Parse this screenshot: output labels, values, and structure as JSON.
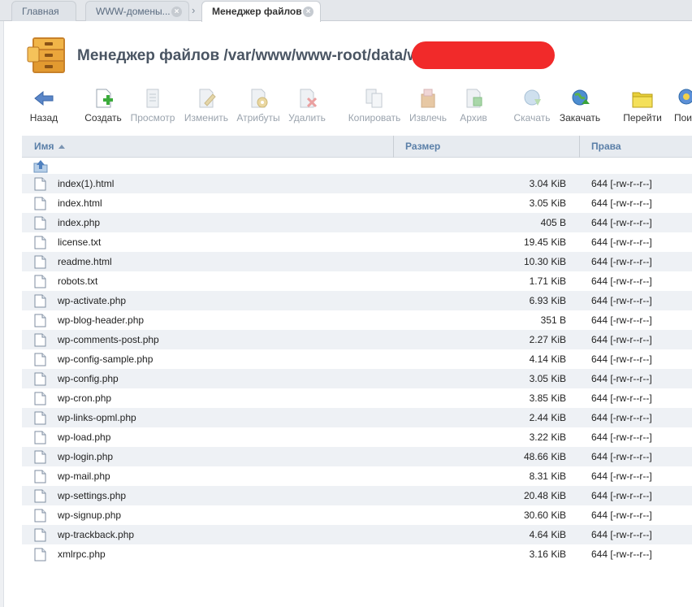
{
  "tabs": {
    "home": "Главная",
    "domains": "WWW-домены...",
    "separator": "›",
    "filemanager": "Менеджер файлов",
    "close_glyph": "×"
  },
  "header": {
    "title": "Менеджер файлов /var/www/www-root/data/ww"
  },
  "toolbar": {
    "back": "Назад",
    "create": "Создать",
    "view": "Просмотр",
    "edit": "Изменить",
    "attributes": "Атрибуты",
    "delete": "Удалить",
    "copy": "Копировать",
    "extract": "Извлечь",
    "archive": "Архив",
    "download": "Скачать",
    "upload": "Закачать",
    "goto": "Перейти",
    "search": "Пои"
  },
  "table": {
    "col_name": "Имя",
    "col_size": "Размер",
    "col_perms": "Права",
    "rows": [
      {
        "name": "index(1).html",
        "size": "3.04 KiB",
        "perms": "644 [-rw-r--r--]"
      },
      {
        "name": "index.html",
        "size": "3.05 KiB",
        "perms": "644 [-rw-r--r--]"
      },
      {
        "name": "index.php",
        "size": "405 B",
        "perms": "644 [-rw-r--r--]"
      },
      {
        "name": "license.txt",
        "size": "19.45 KiB",
        "perms": "644 [-rw-r--r--]"
      },
      {
        "name": "readme.html",
        "size": "10.30 KiB",
        "perms": "644 [-rw-r--r--]"
      },
      {
        "name": "robots.txt",
        "size": "1.71 KiB",
        "perms": "644 [-rw-r--r--]"
      },
      {
        "name": "wp-activate.php",
        "size": "6.93 KiB",
        "perms": "644 [-rw-r--r--]"
      },
      {
        "name": "wp-blog-header.php",
        "size": "351 B",
        "perms": "644 [-rw-r--r--]"
      },
      {
        "name": "wp-comments-post.php",
        "size": "2.27 KiB",
        "perms": "644 [-rw-r--r--]"
      },
      {
        "name": "wp-config-sample.php",
        "size": "4.14 KiB",
        "perms": "644 [-rw-r--r--]"
      },
      {
        "name": "wp-config.php",
        "size": "3.05 KiB",
        "perms": "644 [-rw-r--r--]"
      },
      {
        "name": "wp-cron.php",
        "size": "3.85 KiB",
        "perms": "644 [-rw-r--r--]"
      },
      {
        "name": "wp-links-opml.php",
        "size": "2.44 KiB",
        "perms": "644 [-rw-r--r--]"
      },
      {
        "name": "wp-load.php",
        "size": "3.22 KiB",
        "perms": "644 [-rw-r--r--]"
      },
      {
        "name": "wp-login.php",
        "size": "48.66 KiB",
        "perms": "644 [-rw-r--r--]"
      },
      {
        "name": "wp-mail.php",
        "size": "8.31 KiB",
        "perms": "644 [-rw-r--r--]"
      },
      {
        "name": "wp-settings.php",
        "size": "20.48 KiB",
        "perms": "644 [-rw-r--r--]"
      },
      {
        "name": "wp-signup.php",
        "size": "30.60 KiB",
        "perms": "644 [-rw-r--r--]"
      },
      {
        "name": "wp-trackback.php",
        "size": "4.64 KiB",
        "perms": "644 [-rw-r--r--]"
      },
      {
        "name": "xmlrpc.php",
        "size": "3.16 KiB",
        "perms": "644 [-rw-r--r--]"
      }
    ]
  }
}
